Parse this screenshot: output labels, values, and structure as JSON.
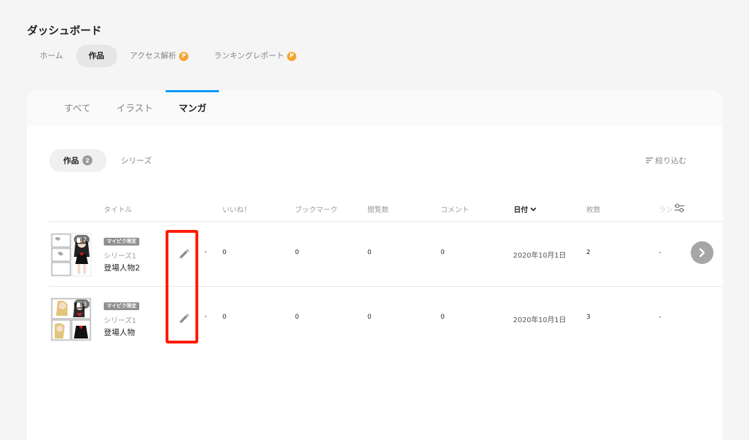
{
  "header": {
    "title": "ダッシュボード",
    "tabs": [
      {
        "label": "ホーム"
      },
      {
        "label": "作品"
      },
      {
        "label": "アクセス解析",
        "badge": "P"
      },
      {
        "label": "ランキングレポート",
        "badge": "P"
      }
    ]
  },
  "content_tabs": [
    {
      "label": "すべて"
    },
    {
      "label": "イラスト"
    },
    {
      "label": "マンガ"
    }
  ],
  "sub_tabs": {
    "works_label": "作品",
    "works_count": "2",
    "series_label": "シリーズ"
  },
  "filter_label": "絞り込む",
  "columns": {
    "title": "タイトル",
    "likes": "いいね！",
    "bookmarks": "ブックマーク",
    "views": "閲覧数",
    "comments": "コメント",
    "date": "日付",
    "pages": "枚数",
    "ranking": "ラン"
  },
  "rows": [
    {
      "thumb_count": "2",
      "tag": "マイピク限定",
      "series": "シリーズ1",
      "title": "登場人物2",
      "likes": "0",
      "bookmarks": "0",
      "views": "0",
      "comments": "0",
      "date": "2020年10月1日",
      "pages": "2",
      "ranking": "-"
    },
    {
      "thumb_count": "3",
      "tag": "マイピク限定",
      "series": "シリーズ1",
      "title": "登場人物",
      "likes": "0",
      "bookmarks": "0",
      "views": "0",
      "comments": "0",
      "date": "2020年10月1日",
      "pages": "3",
      "ranking": "-"
    }
  ],
  "colors": {
    "accent": "#0096fa",
    "highlight": "#ff1a00",
    "premium": "#f6a32f"
  }
}
